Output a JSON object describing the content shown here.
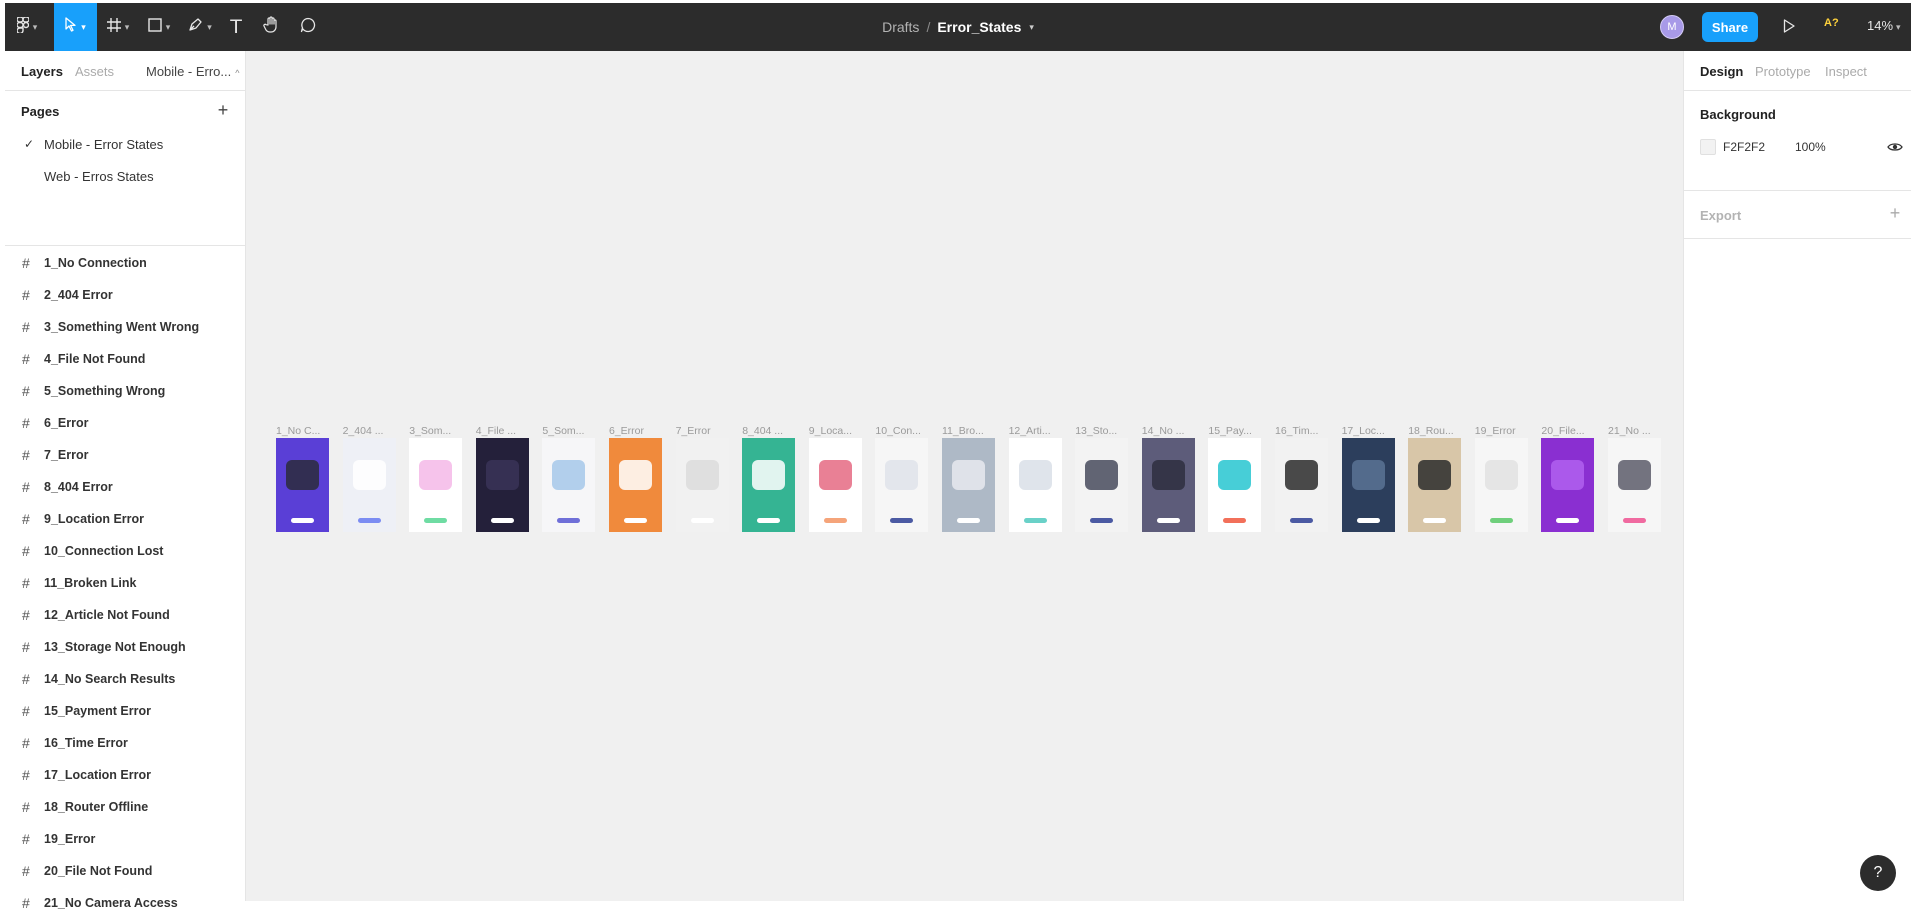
{
  "toolbar": {
    "tools": [
      {
        "name": "main-menu",
        "icon": "figma-logo-icon"
      },
      {
        "name": "move-tool",
        "icon": "cursor-icon",
        "active": true
      },
      {
        "name": "frame-tool",
        "icon": "hash-icon"
      },
      {
        "name": "shape-tool",
        "icon": "rectangle-icon"
      },
      {
        "name": "pen-tool",
        "icon": "pen-icon"
      },
      {
        "name": "text-tool",
        "icon": "text-icon",
        "glyph": "T"
      },
      {
        "name": "hand-tool",
        "icon": "hand-icon"
      },
      {
        "name": "comment-tool",
        "icon": "comment-icon"
      }
    ],
    "breadcrumb_parent": "Drafts",
    "breadcrumb_separator": "/",
    "file_name": "Error_States",
    "avatar_initial": "M",
    "share_label": "Share",
    "accessibility_badge": "A?",
    "zoom": "14%"
  },
  "left_panel": {
    "tab_layers": "Layers",
    "tab_assets": "Assets",
    "current_page": "Mobile - Erro...",
    "pages_title": "Pages",
    "add_page": "+",
    "pages": [
      {
        "label": "Mobile - Error States",
        "selected": true
      },
      {
        "label": "Web - Erros States",
        "selected": false
      }
    ],
    "layers": [
      "1_No Connection",
      "2_404 Error",
      "3_Something Went Wrong",
      "4_File Not Found",
      "5_Something Wrong",
      "6_Error",
      "7_Error",
      "8_404 Error",
      "9_Location Error",
      "10_Connection Lost",
      "11_Broken Link",
      "12_Article Not Found",
      "13_Storage Not Enough",
      "14_No Search Results",
      "15_Payment Error",
      "16_Time Error",
      "17_Location Error",
      "18_Router Offline",
      "19_Error",
      "20_File Not Found",
      "21_No Camera Access"
    ]
  },
  "canvas": {
    "background": "#F0F0F0",
    "frames": [
      {
        "title": "1_No C...",
        "bg": "#5a3fd6",
        "illus": "#2b2b3b",
        "pill": "#ffffff"
      },
      {
        "title": "2_404 ...",
        "bg": "#eef0f6",
        "illus": "#ffffff",
        "pill": "#7b8cf2"
      },
      {
        "title": "3_Som...",
        "bg": "#ffffff",
        "illus": "#f5b8e8",
        "pill": "#6fdca3"
      },
      {
        "title": "4_File ...",
        "bg": "#24203a",
        "illus": "#3a3458",
        "pill": "#ffffff"
      },
      {
        "title": "5_Som...",
        "bg": "#f6f6f8",
        "illus": "#a6c8ea",
        "pill": "#6f6fd8"
      },
      {
        "title": "6_Error",
        "bg": "#f08a3c",
        "illus": "#ffffff",
        "pill": "#ffffff"
      },
      {
        "title": "7_Error",
        "bg": "#f1f1f1",
        "illus": "#dcdcdc",
        "pill": "#ffffff"
      },
      {
        "title": "8_404 ...",
        "bg": "#35b493",
        "illus": "#ffffff",
        "pill": "#ffffff"
      },
      {
        "title": "9_Loca...",
        "bg": "#ffffff",
        "illus": "#e56a82",
        "pill": "#f5a47a"
      },
      {
        "title": "10_Con...",
        "bg": "#f6f6f6",
        "illus": "#dfe3ea",
        "pill": "#4b5aa3"
      },
      {
        "title": "11_Bro...",
        "bg": "#aeb9c6",
        "illus": "#e7e9ee",
        "pill": "#ffffff"
      },
      {
        "title": "12_Arti...",
        "bg": "#ffffff",
        "illus": "#d9dfe8",
        "pill": "#6ad1c8"
      },
      {
        "title": "13_Sto...",
        "bg": "#f3f3f3",
        "illus": "#464a5c",
        "pill": "#4b5aa3"
      },
      {
        "title": "14_No ...",
        "bg": "#5d5c7a",
        "illus": "#2e2e40",
        "pill": "#ffffff"
      },
      {
        "title": "15_Pay...",
        "bg": "#ffffff",
        "illus": "#27c6d0",
        "pill": "#f2705a"
      },
      {
        "title": "16_Tim...",
        "bg": "#f2f2f2",
        "illus": "#2b2b2b",
        "pill": "#4b5aa3"
      },
      {
        "title": "17_Loc...",
        "bg": "#2c3e5c",
        "illus": "#5a7394",
        "pill": "#ffffff"
      },
      {
        "title": "18_Rou...",
        "bg": "#d8c6a8",
        "illus": "#2b2b2b",
        "pill": "#ffffff"
      },
      {
        "title": "19_Error",
        "bg": "#f6f6f6",
        "illus": "#e2e2e2",
        "pill": "#6fcf7c"
      },
      {
        "title": "20_File...",
        "bg": "#8a2fd1",
        "illus": "#b060f0",
        "pill": "#ffffff"
      },
      {
        "title": "21_No ...",
        "bg": "#f6f6f6",
        "illus": "#5c5c6a",
        "pill": "#f06aa0"
      }
    ]
  },
  "right_panel": {
    "tab_design": "Design",
    "tab_prototype": "Prototype",
    "tab_inspect": "Inspect",
    "background_title": "Background",
    "background_hex": "F2F2F2",
    "background_opacity": "100%",
    "background_color": "#F2F2F2",
    "export_title": "Export",
    "add_export": "+"
  },
  "help": "?",
  "colors": {
    "accent": "#18A0FB",
    "toolbar": "#2C2C2C"
  }
}
